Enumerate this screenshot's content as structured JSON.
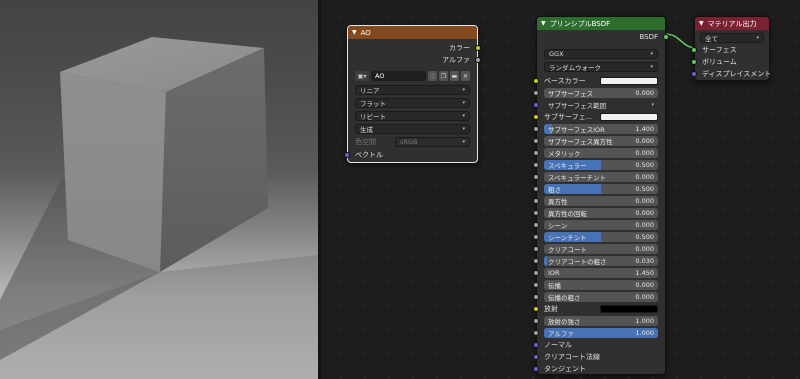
{
  "ao_node": {
    "title": "AO",
    "outputs": [
      "カラー",
      "アルファ"
    ],
    "image_name": "AO",
    "interpolation": "リニア",
    "projection": "フラット",
    "extension": "リピート",
    "source": "生成",
    "colorspace_label": "色空間",
    "colorspace_value": "sRGB",
    "input": "ベクトル"
  },
  "bsdf_node": {
    "title": "プリンシプルBSDF",
    "output": "BSDF",
    "distribution": "GGX",
    "sss_method": "ランダムウォーク",
    "inputs": [
      {
        "label": "ベースカラー",
        "kind": "color",
        "color": "#f2f2f2",
        "sock": "yellow"
      },
      {
        "label": "サブサーフェス",
        "value": "0.000",
        "fill": 0,
        "sock": "grey"
      },
      {
        "label": "サブサーフェス範囲",
        "kind": "dropdown",
        "sock": "purple"
      },
      {
        "label": "サブサーフェ...",
        "kind": "color",
        "color": "#f2f2f2",
        "sock": "yellow"
      },
      {
        "label": "サブサーフェスIOR",
        "value": "1.400",
        "fill": 0.07,
        "sock": "grey"
      },
      {
        "label": "サブサーフェス異方性",
        "value": "0.000",
        "fill": 0,
        "sock": "grey"
      },
      {
        "label": "メタリック",
        "value": "0.000",
        "fill": 0,
        "sock": "grey"
      },
      {
        "label": "スペキュラー",
        "value": "0.500",
        "fill": 0.5,
        "sock": "grey"
      },
      {
        "label": "スペキュラーチント",
        "value": "0.000",
        "fill": 0,
        "sock": "grey"
      },
      {
        "label": "粗さ",
        "value": "0.500",
        "fill": 0.5,
        "sock": "grey"
      },
      {
        "label": "異方性",
        "value": "0.000",
        "fill": 0,
        "sock": "grey"
      },
      {
        "label": "異方性の回転",
        "value": "0.000",
        "fill": 0,
        "sock": "grey"
      },
      {
        "label": "シーン",
        "value": "0.000",
        "fill": 0,
        "sock": "grey"
      },
      {
        "label": "シーンチント",
        "value": "0.500",
        "fill": 0.5,
        "sock": "grey"
      },
      {
        "label": "クリアコート",
        "value": "0.000",
        "fill": 0,
        "sock": "grey"
      },
      {
        "label": "クリアコートの粗さ",
        "value": "0.030",
        "fill": 0.03,
        "sock": "grey"
      },
      {
        "label": "IOR",
        "value": "1.450",
        "fill": 0,
        "sock": "grey"
      },
      {
        "label": "伝播",
        "value": "0.000",
        "fill": 0,
        "sock": "grey"
      },
      {
        "label": "伝播の粗さ",
        "value": "0.000",
        "fill": 0,
        "sock": "grey"
      },
      {
        "label": "放射",
        "kind": "color",
        "color": "#000000",
        "sock": "yellow"
      },
      {
        "label": "放射の強さ",
        "value": "1.000",
        "fill": 0,
        "sock": "grey"
      },
      {
        "label": "アルファ",
        "value": "1.000",
        "fill": 1,
        "sock": "grey"
      },
      {
        "label": "ノーマル",
        "kind": "socket",
        "sock": "purple"
      },
      {
        "label": "クリアコート法線",
        "kind": "socket",
        "sock": "purple"
      },
      {
        "label": "タンジェント",
        "kind": "socket",
        "sock": "purple"
      }
    ]
  },
  "output_node": {
    "title": "マテリアル出力",
    "target": "全て",
    "inputs": [
      "サーフェス",
      "ボリューム",
      "ディスプレイスメント"
    ]
  },
  "colors": {
    "ao_header": "#83491f",
    "bsdf_header": "#2d6d2d",
    "output_header": "#7a2231",
    "accent": "#4772b3"
  }
}
